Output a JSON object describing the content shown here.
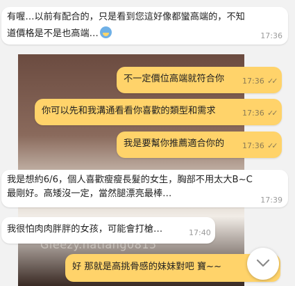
{
  "background_photo": {
    "overlay_text": "Gleezy.hatlang0815"
  },
  "messages": [
    {
      "direction": "incoming",
      "lines": [
        "有喔…以前有配合的，只是看到您這好像都蠻高端的，不知",
        "道價格是不是也高端…"
      ],
      "emoji": "anxious-face",
      "time": "17:36"
    },
    {
      "direction": "outgoing",
      "text": "不一定價位高端就符合你",
      "time": "17:36",
      "status": "read"
    },
    {
      "direction": "outgoing",
      "text": "你可以先和我溝通看看你喜歡的類型和需求",
      "time": "17:36",
      "status": "read"
    },
    {
      "direction": "outgoing",
      "text": "我是要幫你推薦適合你的",
      "time": "17:36",
      "status": "read"
    },
    {
      "direction": "incoming",
      "lines": [
        "我是想約6/6，個人喜歡瘦瘦長髮的女生，胸部不用太大B~C",
        "最剛好。高矮沒一定，當然腿漂亮最棒…"
      ],
      "time": "17:39"
    },
    {
      "direction": "incoming",
      "text": "我很怕肉肉胖胖的女孩，可能會打槍…",
      "time": "17:40"
    },
    {
      "direction": "outgoing",
      "text": "好 那就是高挑骨感的妹妹對吧 寶~~",
      "time": ""
    }
  ],
  "colors": {
    "incoming_bg": "#ffffff",
    "outgoing_bg": "#ffd36a",
    "read_ticks": "#8a7a55"
  }
}
